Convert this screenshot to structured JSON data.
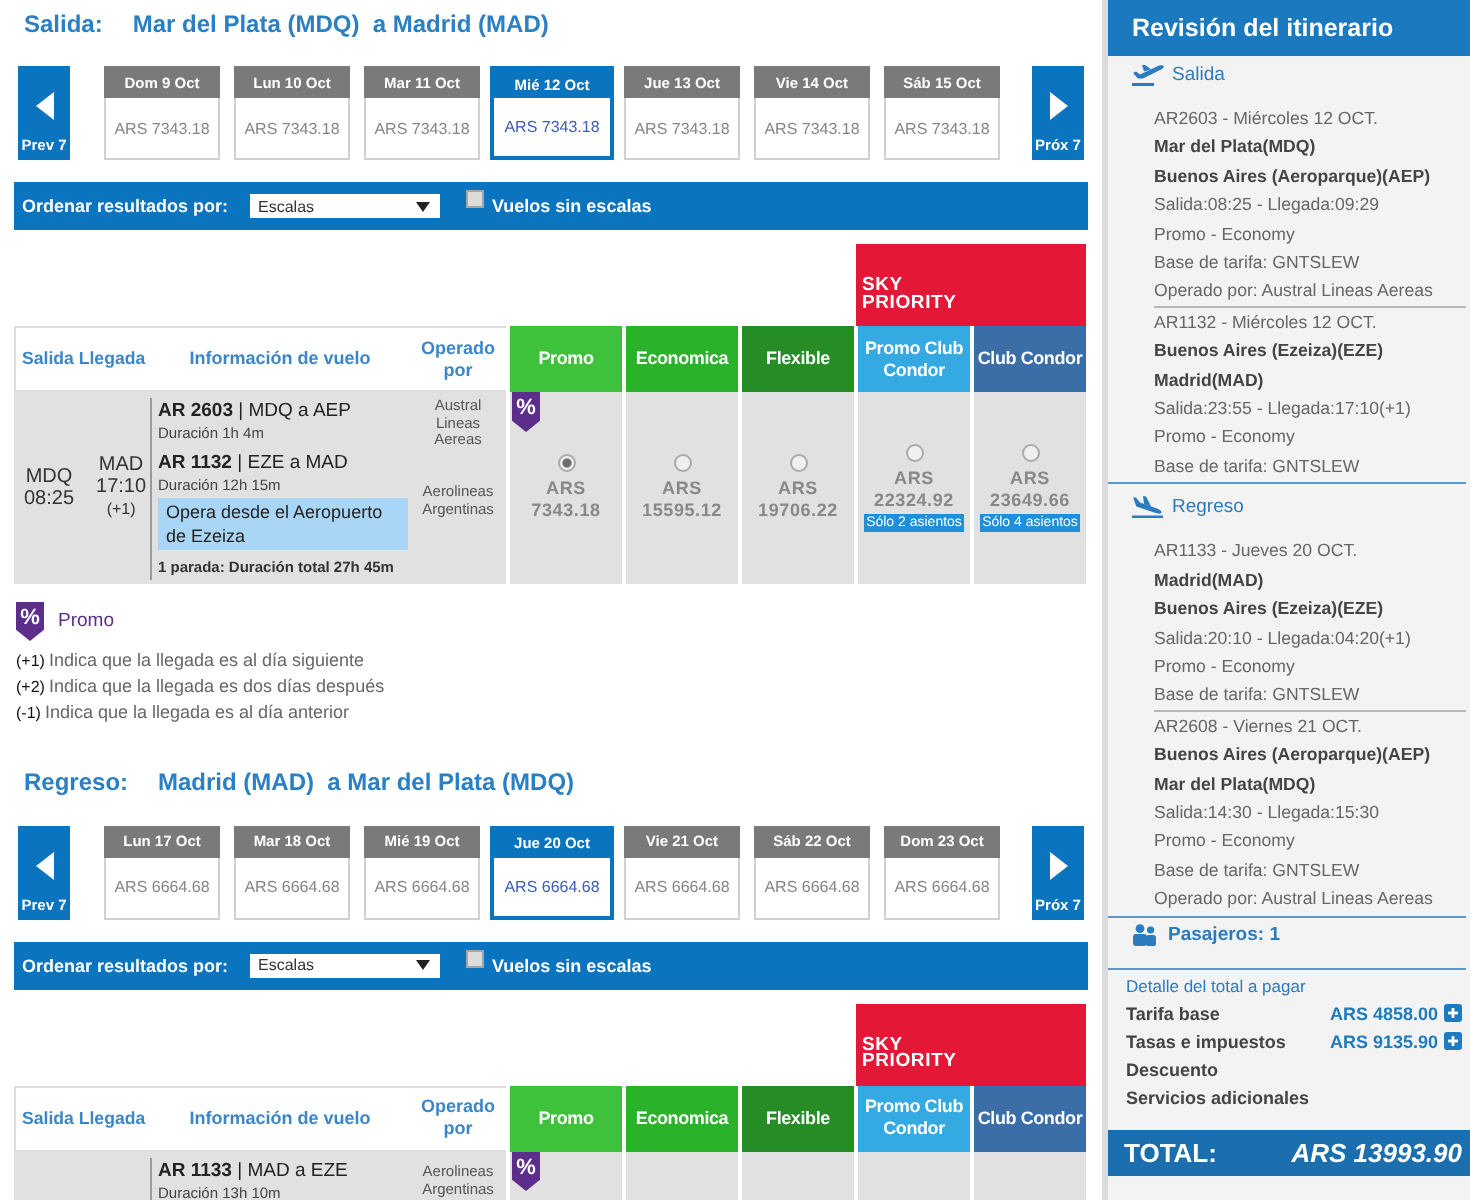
{
  "outbound": {
    "label": "Salida:",
    "route": "Mar del Plata (MDQ)  a Madrid (MAD)",
    "prev": "Prev 7",
    "next": "Próx 7",
    "dates": [
      {
        "day": "Dom 9 Oct",
        "price": "ARS 7343.18",
        "selected": false
      },
      {
        "day": "Lun 10 Oct",
        "price": "ARS 7343.18",
        "selected": false
      },
      {
        "day": "Mar 11 Oct",
        "price": "ARS 7343.18",
        "selected": false
      },
      {
        "day": "Mié 12 Oct",
        "price": "ARS 7343.18",
        "selected": true
      },
      {
        "day": "Jue 13 Oct",
        "price": "ARS 7343.18",
        "selected": false
      },
      {
        "day": "Vie 14 Oct",
        "price": "ARS 7343.18",
        "selected": false
      },
      {
        "day": "Sáb 15 Oct",
        "price": "ARS 7343.18",
        "selected": false
      }
    ],
    "sort": {
      "label": "Ordenar resultados por:",
      "value": "Escalas",
      "nonstop_label": "Vuelos sin escalas",
      "nonstop_checked": false
    },
    "banner": "SKY PRIORITY",
    "columns": [
      {
        "label": "Salida Llegada",
        "kind": "info"
      },
      {
        "label": "Información de vuelo",
        "kind": "info"
      },
      {
        "label": "Operado por",
        "kind": "info"
      },
      {
        "label": "Promo",
        "kind": "fare",
        "color": "#3ec23c"
      },
      {
        "label": "Economica",
        "kind": "fare",
        "color": "#2bb22b"
      },
      {
        "label": "Flexible",
        "kind": "fare",
        "color": "#268d26"
      },
      {
        "label": "Promo Club Condor",
        "kind": "fare",
        "color": "#35a9e1"
      },
      {
        "label": "Club Condor",
        "kind": "fare",
        "color": "#3b6ea6"
      }
    ],
    "flights": [
      {
        "departure": {
          "airport": "MDQ",
          "time": "08:25"
        },
        "arrival": {
          "airport": "MAD",
          "time": "17:10",
          "offset": "(+1)"
        },
        "segments": [
          {
            "flight": "**AR 2603** | MDQ a AEP",
            "duration": "Duración 1h 4m",
            "operator": "Austral Lineas Aereas"
          },
          {
            "flight": "**AR 1132** | EZE a MAD",
            "duration": "Duración 12h 15m",
            "note": "Opera desde el Aeropuerto de Ezeiza",
            "operator": "Aerolineas Argentinas"
          }
        ],
        "summary": "1 parada: Duración total 27h 45m",
        "fares": [
          {
            "badge": "%",
            "price": "ARS 7343.18",
            "selected": true
          },
          {
            "price": "ARS 15595.12",
            "selected": false
          },
          {
            "price": "ARS 19706.22",
            "selected": false
          },
          {
            "price": "ARS 22324.92",
            "selected": false,
            "seats": "Sólo 2 asientos"
          },
          {
            "price": "ARS 23649.66",
            "selected": false,
            "seats": "Sólo 4 asientos"
          }
        ]
      }
    ]
  },
  "legend": {
    "badge": "%",
    "label": "Promo",
    "notes": [
      {
        "mark": "(+1)",
        "text": "Indica que la llegada es al día siguiente"
      },
      {
        "mark": "(+2)",
        "text": "Indica que la llegada es dos días después"
      },
      {
        "mark": "(-1)",
        "text": "Indica que la llegada es al día anterior"
      }
    ]
  },
  "return": {
    "label": "Regreso:",
    "route": "Madrid (MAD)  a Mar del Plata (MDQ)",
    "prev": "Prev 7",
    "next": "Próx 7",
    "dates": [
      {
        "day": "Lun 17 Oct",
        "price": "ARS 6664.68",
        "selected": false
      },
      {
        "day": "Mar 18 Oct",
        "price": "ARS 6664.68",
        "selected": false
      },
      {
        "day": "Mié 19 Oct",
        "price": "ARS 6664.68",
        "selected": false
      },
      {
        "day": "Jue 20 Oct",
        "price": "ARS 6664.68",
        "selected": true
      },
      {
        "day": "Vie 21 Oct",
        "price": "ARS 6664.68",
        "selected": false
      },
      {
        "day": "Sáb 22 Oct",
        "price": "ARS 6664.68",
        "selected": false
      },
      {
        "day": "Dom 23 Oct",
        "price": "ARS 6664.68",
        "selected": false
      }
    ],
    "sort": {
      "label": "Ordenar resultados por:",
      "value": "Escalas",
      "nonstop_label": "Vuelos sin escalas",
      "nonstop_checked": false
    },
    "banner": "SKY PRIORITY",
    "columns": [
      {
        "label": "Salida Llegada",
        "kind": "info"
      },
      {
        "label": "Información de vuelo",
        "kind": "info"
      },
      {
        "label": "Operado por",
        "kind": "info"
      },
      {
        "label": "Promo",
        "kind": "fare",
        "color": "#3ec23c"
      },
      {
        "label": "Economica",
        "kind": "fare",
        "color": "#2bb22b"
      },
      {
        "label": "Flexible",
        "kind": "fare",
        "color": "#268d26"
      },
      {
        "label": "Promo Club Condor",
        "kind": "fare",
        "color": "#35a9e1"
      },
      {
        "label": "Club Condor",
        "kind": "fare",
        "color": "#3b6ea6"
      }
    ],
    "flights": [
      {
        "segments": [
          {
            "flight": "**AR 1133** | MAD a EZE",
            "duration": "Duración 13h 10m",
            "operator": "Aerolineas Argentinas"
          }
        ],
        "fares": [
          {
            "badge": "%"
          }
        ]
      }
    ]
  },
  "itinerary": {
    "title": "Revisión del itinerario",
    "sections": [
      {
        "kind": "departure",
        "label": "Salida",
        "segments": [
          {
            "header": "AR2603 - Miércoles 12 OCT.",
            "origin": "Mar del Plata(MDQ)",
            "destination": "Buenos Aires (Aeroparque)(AEP)",
            "times": "Salida:08:25 - Llegada:09:29",
            "fare": "Promo - Economy",
            "basis": "Base de tarifa: GNTSLEW",
            "operator": "Operado por: Austral Lineas Aereas"
          },
          {
            "header": "AR1132 - Miércoles 12 OCT.",
            "origin": "Buenos Aires (Ezeiza)(EZE)",
            "destination": "Madrid(MAD)",
            "times": "Salida:23:55 - Llegada:17:10(+1)",
            "fare": "Promo - Economy",
            "basis": "Base de tarifa: GNTSLEW"
          }
        ]
      },
      {
        "kind": "return",
        "label": "Regreso",
        "segments": [
          {
            "header": "AR1133 - Jueves 20 OCT.",
            "origin": "Madrid(MAD)",
            "destination": "Buenos Aires (Ezeiza)(EZE)",
            "times": "Salida:20:10 - Llegada:04:20(+1)",
            "fare": "Promo - Economy",
            "basis": "Base de tarifa: GNTSLEW"
          },
          {
            "header": "AR2608 - Viernes 21 OCT.",
            "origin": "Buenos Aires (Aeroparque)(AEP)",
            "destination": "Mar del Plata(MDQ)",
            "times": "Salida:14:30 - Llegada:15:30",
            "fare": "Promo - Economy",
            "basis": "Base de tarifa: GNTSLEW",
            "operator": "Operado por: Austral Lineas Aereas"
          }
        ]
      }
    ],
    "passengers": "Pasajeros: 1",
    "breakdown": {
      "title": "Detalle del total a pagar",
      "rows": [
        {
          "label": "Tarifa base",
          "amount": "ARS 4858.00",
          "expandable": true
        },
        {
          "label": "Tasas e impuestos",
          "amount": "ARS 9135.90",
          "expandable": true
        },
        {
          "label": "Descuento",
          "expandable": false
        },
        {
          "label": "Servicios adicionales",
          "expandable": false
        }
      ]
    },
    "total": {
      "label": "TOTAL:",
      "amount": "ARS 13993.90"
    }
  }
}
